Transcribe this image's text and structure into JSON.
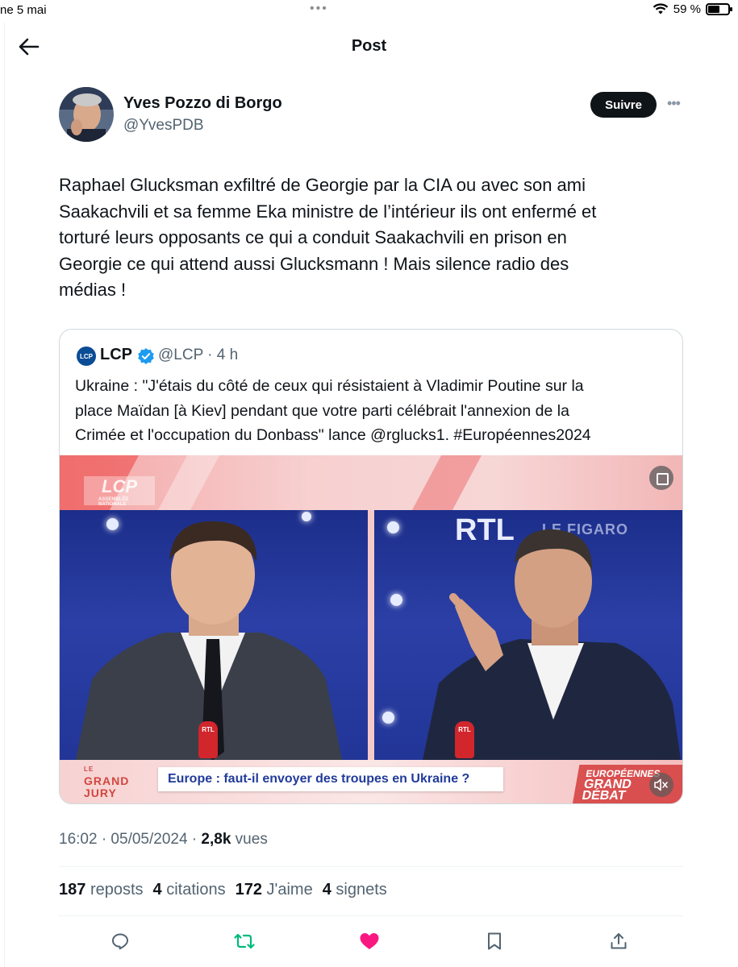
{
  "status_bar": {
    "time": "ne 5 mai",
    "dots": "•••",
    "battery": "59 %",
    "battery_level": 0.59
  },
  "header": {
    "title": "Post"
  },
  "author": {
    "name": "Yves Pozzo di Borgo",
    "handle": "@YvesPDB",
    "follow_label": "Suivre",
    "more": "•••"
  },
  "tweet": {
    "lines": [
      "Raphael Glucksman exfiltré de Georgie par la CIA ou avec son ami",
      "Saakachvili et sa femme Eka ministre de l’intérieur ils ont enfermé et",
      "torturé leurs opposants ce qui a conduit Saakachvili en prison en",
      "Georgie ce qui attend aussi Glucksmann ! Mais silence radio des",
      "médias !"
    ]
  },
  "quote": {
    "logo": "LCP",
    "name": "LCP",
    "handle": "@LCP · 4 h",
    "lines": [
      "Ukraine : \"J'étais du côté de ceux qui résistaient à Vladimir Poutine sur la",
      "place Maïdan [à Kiev] pendant que votre parti célébrait l'annexion de la",
      "Crimée et l'occupation du Donbass\" lance @rglucks1. #Européennes2024"
    ],
    "media": {
      "lcp_logo": "LCP",
      "lcp_sub": "ASSEMBLÉE NATIONALE",
      "rtl": "RTL",
      "figaro": "LE FIGARO",
      "mic_label": "RTL",
      "show_line1": "LE",
      "show_line2": "GRAND",
      "show_line3": "JURY",
      "banner": "Europe : faut-il envoyer des troupes en Ukraine ?",
      "event_line1": "EUROPÉENNES",
      "event_line2": "GRAND DÉBAT"
    }
  },
  "meta": {
    "time": "16:02 · 05/05/2024 · ",
    "views": "2,8k",
    "views_label": " vues"
  },
  "stats": [
    {
      "count": "187",
      "label": "reposts"
    },
    {
      "count": "4",
      "label": "citations"
    },
    {
      "count": "172",
      "label": "J'aime"
    },
    {
      "count": "4",
      "label": "signets"
    }
  ],
  "colors": {
    "like": "#f91880",
    "repost": "#00ba7c",
    "secondary": "#536471",
    "border": "#cfd9de",
    "verified": "#1d9bf0"
  }
}
